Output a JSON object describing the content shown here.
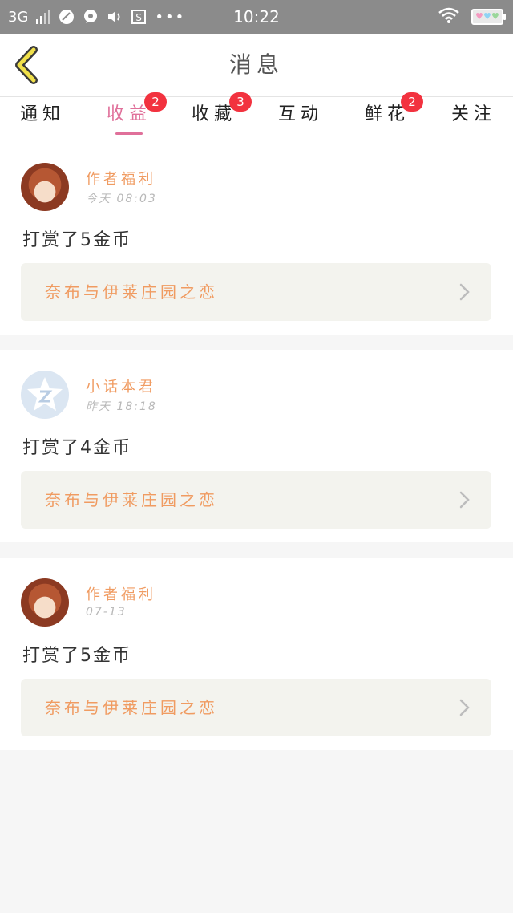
{
  "status_bar": {
    "network": "3G",
    "time": "10:22",
    "icons": [
      "signal-icon",
      "app-icon",
      "chat-icon",
      "volume-icon",
      "s-app-icon",
      "more-icon",
      "wifi-icon",
      "battery-icon"
    ]
  },
  "header": {
    "title": "消息",
    "back_icon": "chevron-left-icon"
  },
  "tabs": [
    {
      "label": "通知",
      "badge": ""
    },
    {
      "label": "收益",
      "badge": "2",
      "active": true
    },
    {
      "label": "收藏",
      "badge": "3"
    },
    {
      "label": "互动",
      "badge": ""
    },
    {
      "label": "鲜花",
      "badge": "2"
    },
    {
      "label": "关注",
      "badge": ""
    }
  ],
  "messages": [
    {
      "sender": "作者福利",
      "time": "今天 08:03",
      "content": "打赏了5金币",
      "link_text": "奈布与伊莱庄园之恋",
      "avatar": "anime-girl-avatar"
    },
    {
      "sender": "小话本君",
      "time": "昨天 18:18",
      "content": "打赏了4金币",
      "link_text": "奈布与伊莱庄园之恋",
      "avatar": "z-logo-avatar"
    },
    {
      "sender": "作者福利",
      "time": "07-13",
      "content": "打赏了5金币",
      "link_text": "奈布与伊莱庄园之恋",
      "avatar": "anime-girl-avatar"
    }
  ],
  "colors": {
    "accent": "#e0709a",
    "sender": "#f09b61",
    "badge": "#f2323f",
    "status_bar": "#8b8b8b"
  }
}
